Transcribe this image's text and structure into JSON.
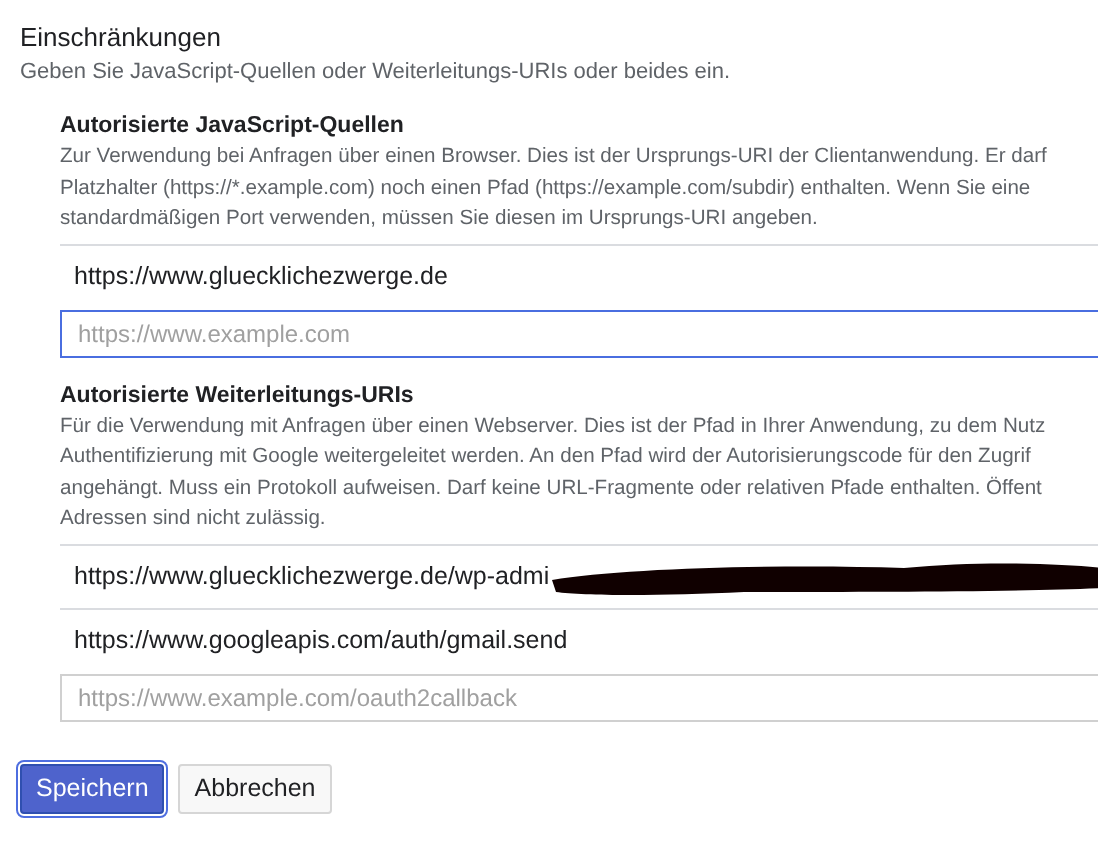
{
  "title": "Einschränkungen",
  "subtitle": "Geben Sie JavaScript-Quellen oder Weiterleitungs-URIs oder beides ein.",
  "sections": [
    {
      "heading": "Autorisierte JavaScript-Quellen",
      "description_lines": [
        "Zur Verwendung bei Anfragen über einen Browser. Dies ist der Ursprungs-URI der Clientanwendung. Er darf",
        "Platzhalter (https://*.example.com) noch einen Pfad (https://example.com/subdir) enthalten. Wenn Sie eine",
        "standardmäßigen Port verwenden, müssen Sie diesen im Ursprungs-URI angeben."
      ],
      "uris": [
        {
          "value": "https://www.gluecklichezwerge.de",
          "redacted": false
        }
      ],
      "field": {
        "placeholder": "https://www.example.com",
        "focused": true
      }
    },
    {
      "heading": "Autorisierte Weiterleitungs-URIs",
      "description_lines": [
        "Für die Verwendung mit Anfragen über einen Webserver. Dies ist der Pfad in Ihrer Anwendung, zu dem Nutz",
        "Authentifizierung mit Google weitergeleitet werden. An den Pfad wird der Autorisierungscode für den Zugrif",
        "angehängt. Muss ein Protokoll aufweisen. Darf keine URL-Fragmente oder relativen Pfade enthalten. Öffent",
        "Adressen sind nicht zulässig."
      ],
      "uris": [
        {
          "value": "https://www.gluecklichezwerge.de/wp-admi",
          "redacted": true
        },
        {
          "value": "https://www.googleapis.com/auth/gmail.send",
          "redacted": false
        }
      ],
      "field": {
        "placeholder": "https://www.example.com/oauth2callback",
        "focused": false
      }
    }
  ],
  "buttons": [
    {
      "label": "Speichern",
      "kind": "primary"
    },
    {
      "label": "Abbrechen",
      "kind": "secondary"
    }
  ]
}
